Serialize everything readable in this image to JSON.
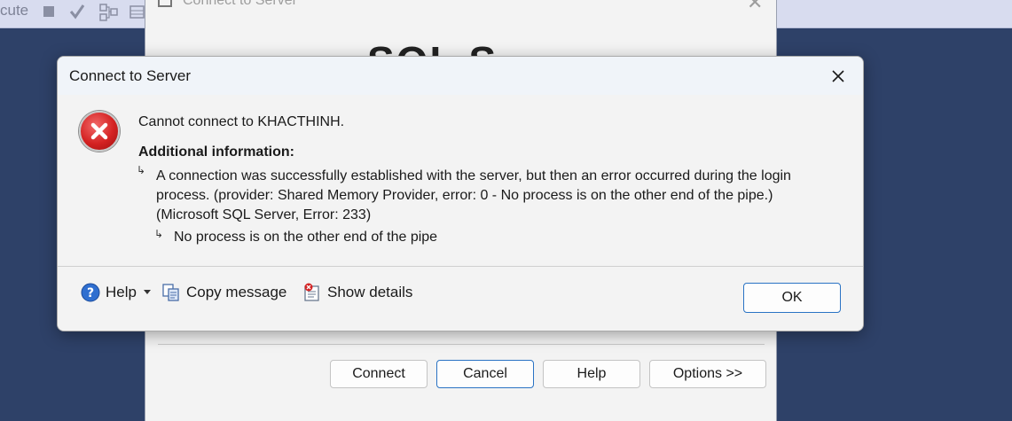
{
  "app_toolbar": {
    "partial_text": "cute"
  },
  "background_dialog": {
    "title": "Connect to Server",
    "banner_text": "SQL S",
    "buttons": {
      "connect": "Connect",
      "cancel": "Cancel",
      "help": "Help",
      "options": "Options >>"
    }
  },
  "error_dialog": {
    "title": "Connect to Server",
    "message": "Cannot connect to KHACTHINH.",
    "additional_info_title": "Additional information:",
    "detail": "A connection was successfully established with the server, but then an error occurred during the login process. (provider: Shared Memory Provider, error: 0 - No process is on the other end of the pipe.) (Microsoft SQL Server, Error: 233)",
    "inner_detail": "No process is on the other end of the pipe",
    "arrow_glyph": "↳",
    "footer": {
      "help_label": "Help",
      "copy_label": "Copy message",
      "details_label": "Show details",
      "ok_label": "OK"
    }
  },
  "colors": {
    "desktop_bg": "#2e4168",
    "toolbar_bg": "#d8dcef",
    "dialog_bg": "#f3f3f3",
    "titlebar_bg": "#f0f4f9",
    "accent_border": "#2a73c4",
    "error_red": "#d42222"
  },
  "icons": {
    "error": "error-x-icon",
    "help": "help-question-icon",
    "copy": "copy-icon",
    "details": "show-details-icon",
    "close": "close-icon",
    "dropdown": "dropdown-arrow-icon"
  }
}
